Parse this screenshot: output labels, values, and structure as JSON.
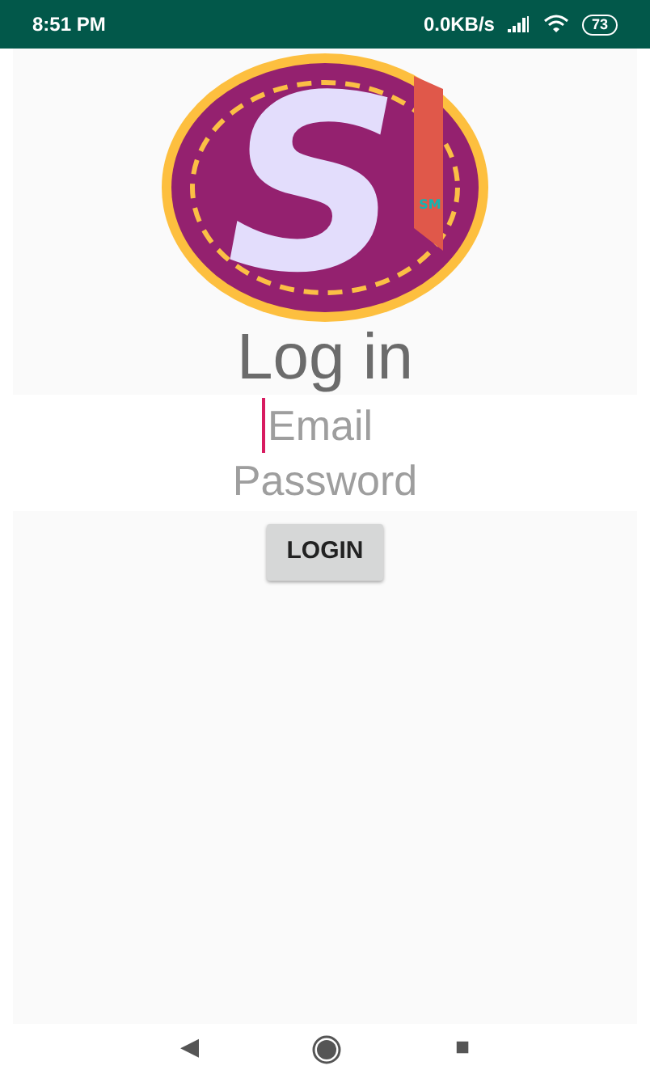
{
  "status_bar": {
    "time": "8:51 PM",
    "speed": "0.0KB/s",
    "battery": "73"
  },
  "logo": {
    "letter": "S",
    "tag": "SM"
  },
  "title": "Log in",
  "fields": [
    {
      "placeholder": "Email",
      "focused": true
    },
    {
      "placeholder": "Password",
      "focused": false
    }
  ],
  "login_button": "LOGIN",
  "nav_bar": {
    "back": "◀",
    "recents": "■"
  }
}
